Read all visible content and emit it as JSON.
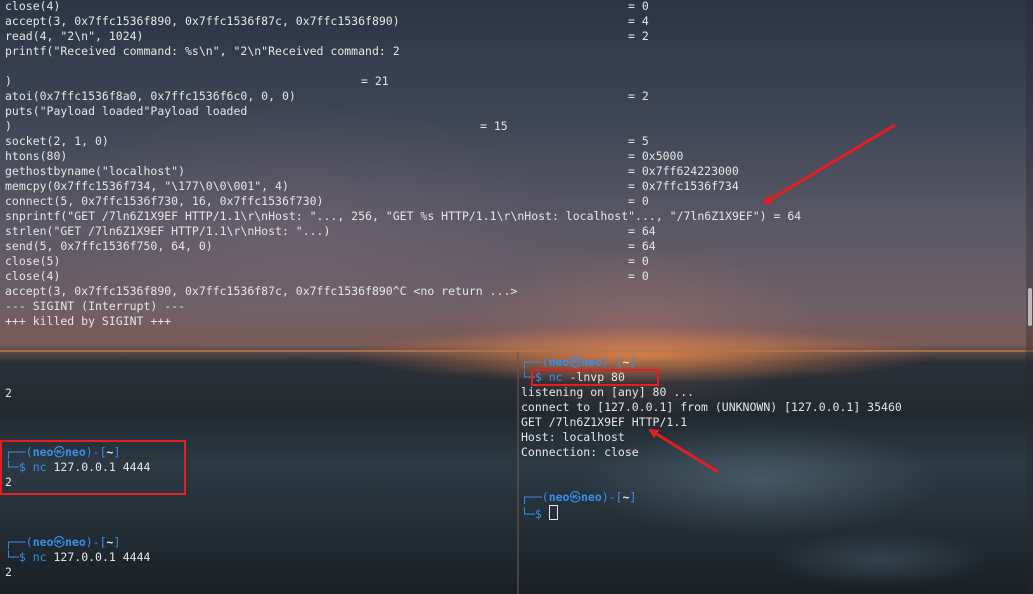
{
  "top": {
    "lines": [
      {
        "left": "close(4)",
        "right": "= 0"
      },
      {
        "left": "accept(3, 0x7ffc1536f890, 0x7ffc1536f87c, 0x7ffc1536f890)",
        "right": "= 4"
      },
      {
        "left": "read(4, \"2\\n\", 1024)",
        "right": "= 2"
      },
      {
        "left": "printf(\"Received command: %s\\n\", \"2\\n\"Received command: 2",
        "right": ""
      },
      {
        "left": "",
        "right": ""
      },
      {
        "left": ")",
        "mid": "= 21"
      },
      {
        "left": "atoi(0x7ffc1536f8a0, 0x7ffc1536f6c0, 0, 0)",
        "right": "= 2"
      },
      {
        "left": "puts(\"Payload loaded\"Payload loaded",
        "right": ""
      },
      {
        "left": ")",
        "mid2": "= 15"
      },
      {
        "left": "socket(2, 1, 0)",
        "right": "= 5"
      },
      {
        "left": "htons(80)",
        "right": "= 0x5000"
      },
      {
        "left": "gethostbyname(\"localhost\")",
        "right": "= 0x7ff624223000"
      },
      {
        "left": "memcpy(0x7ffc1536f734, \"\\177\\0\\0\\001\", 4)",
        "right": "= 0x7ffc1536f734"
      },
      {
        "left": "connect(5, 0x7ffc1536f730, 16, 0x7ffc1536f730)",
        "right": "= 0"
      },
      {
        "left": "snprintf(\"GET /7ln6Z1X9EF HTTP/1.1\\r\\nHost: \"..., 256, \"GET %s HTTP/1.1\\r\\nHost: localhost\"..., \"/7ln6Z1X9EF\") = 64",
        "right": ""
      },
      {
        "left": "strlen(\"GET /7ln6Z1X9EF HTTP/1.1\\r\\nHost: \"...)",
        "right": "= 64"
      },
      {
        "left": "send(5, 0x7ffc1536f750, 64, 0)",
        "right": "= 64"
      },
      {
        "left": "close(5)",
        "right": "= 0"
      },
      {
        "left": "close(4)",
        "right": "= 0"
      },
      {
        "left": "accept(3, 0x7ffc1536f890, 0x7ffc1536f87c, 0x7ffc1536f890^C <no return ...>",
        "right": ""
      },
      {
        "left": "--- SIGINT (Interrupt) ---",
        "right": ""
      },
      {
        "left": "+++ killed by SIGINT +++",
        "right": ""
      }
    ]
  },
  "bottom_left": {
    "output_top": "2",
    "prompt1": {
      "frame_top": "┌──(",
      "user": "neo",
      "skull": "㉿",
      "host": "neo",
      "path_open": ")-[",
      "path": "~",
      "path_close": "]",
      "frame_bot": "└─",
      "dollar": "$ ",
      "cmd": "nc",
      "args": " 127.0.0.1 4444"
    },
    "output1": "2",
    "prompt2": {
      "frame_top": "┌──(",
      "user": "neo",
      "skull": "㉿",
      "host": "neo",
      "path_open": ")-[",
      "path": "~",
      "path_close": "]",
      "frame_bot": "└─",
      "dollar": "$ ",
      "cmd": "nc",
      "args": " 127.0.0.1 4444"
    },
    "output2": "2"
  },
  "bottom_right": {
    "prompt1": {
      "frame_top": "┌──(",
      "user": "neo",
      "skull": "㉿",
      "host": "neo",
      "path_open": ")-[",
      "path": "~",
      "path_close": "]",
      "frame_bot": "└─",
      "dollar": "$ ",
      "cmd": "nc",
      "args": " -lnvp 80"
    },
    "listen": "listening on [any] 80 ...",
    "connect": "connect to [127.0.0.1] from (UNKNOWN) [127.0.0.1] 35460",
    "get": "GET /7ln6Z1X9EF HTTP/1.1",
    "host": "Host: localhost",
    "connection": "Connection: close",
    "prompt2": {
      "frame_top": "┌──(",
      "user": "neo",
      "skull": "㉿",
      "host": "neo",
      "path_open": ")-[",
      "path": "~",
      "path_close": "]",
      "frame_bot": "└─",
      "dollar": "$ "
    }
  },
  "colors": {
    "accent": "#3b8eea",
    "highlight": "#e51f1f",
    "text": "#e6e6e6"
  }
}
